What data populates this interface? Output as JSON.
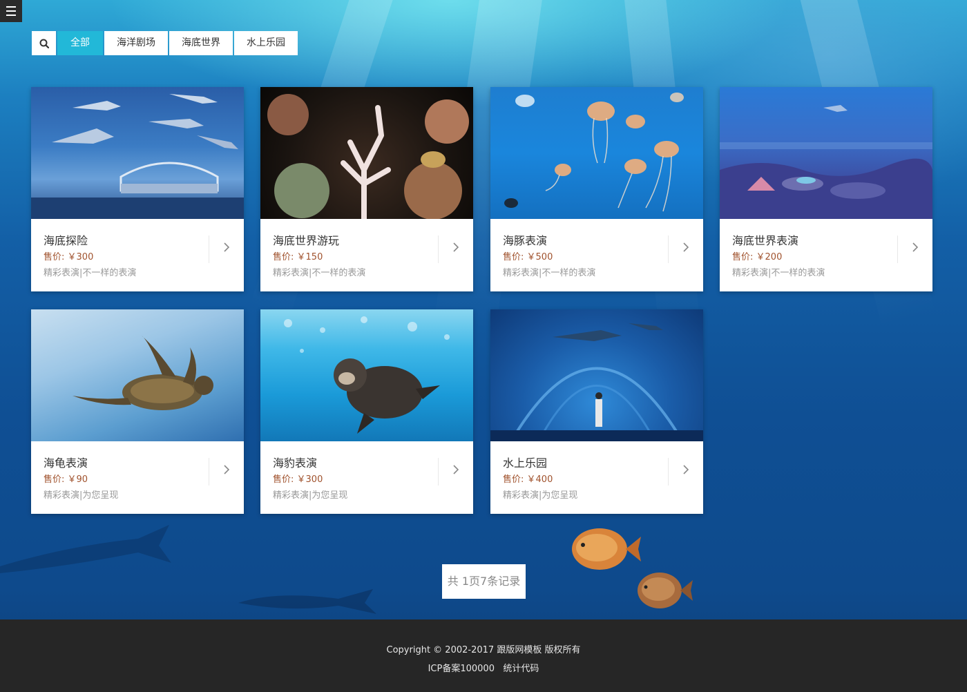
{
  "filter": {
    "search_icon": "search-icon",
    "tabs": [
      {
        "label": "全部",
        "active": true
      },
      {
        "label": "海洋剧场",
        "active": false
      },
      {
        "label": "海底世界",
        "active": false
      },
      {
        "label": "水上乐园",
        "active": false
      }
    ]
  },
  "cards": [
    {
      "title": "海底探险",
      "price_label": "售价:",
      "price": "￥300",
      "desc": "精彩表演|不一样的表演"
    },
    {
      "title": "海底世界游玩",
      "price_label": "售价:",
      "price": "￥150",
      "desc": "精彩表演|不一样的表演"
    },
    {
      "title": "海豚表演",
      "price_label": "售价:",
      "price": "￥500",
      "desc": "精彩表演|不一样的表演"
    },
    {
      "title": "海底世界表演",
      "price_label": "售价:",
      "price": "￥200",
      "desc": "精彩表演|不一样的表演"
    },
    {
      "title": "海龟表演",
      "price_label": "售价:",
      "price": "￥90",
      "desc": "精彩表演|为您呈现"
    },
    {
      "title": "海豹表演",
      "price_label": "售价:",
      "price": "￥300",
      "desc": "精彩表演|为您呈现"
    },
    {
      "title": "水上乐园",
      "price_label": "售价:",
      "price": "￥400",
      "desc": "精彩表演|为您呈现"
    }
  ],
  "pager": {
    "text": "共 1页7条记录"
  },
  "footer": {
    "copyright": "Copyright © 2002-2017",
    "company": "跟版网模板",
    "rights": "版权所有",
    "icp": "ICP备案100000",
    "stats": "统计代码"
  },
  "colors": {
    "accent": "#22b8d8",
    "price": "#a0522d",
    "footer_bg": "#262626"
  }
}
